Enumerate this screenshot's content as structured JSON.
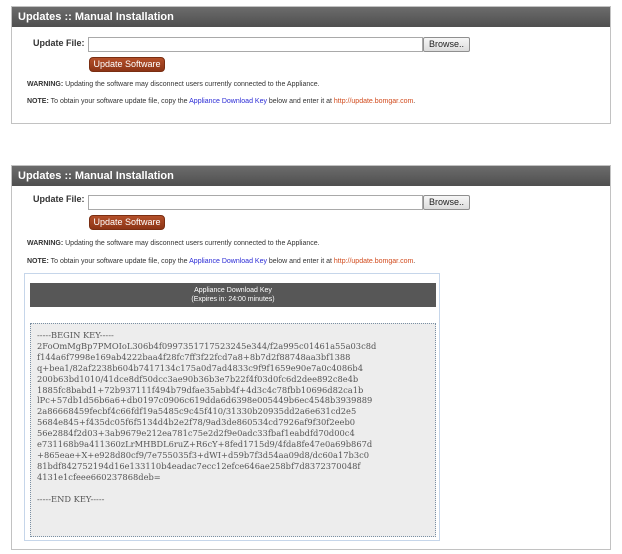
{
  "panel1": {
    "title": "Updates :: Manual Installation",
    "file_label": "Update File:",
    "browse_label": "Browse..",
    "update_button": "Update Software",
    "warning_prefix": "WARNING:",
    "warning_text": " Updating the software may disconnect users currently connected to the Appliance.",
    "note_prefix": "NOTE:",
    "note_text": " To obtain your software update file, copy the ",
    "note_key_link": "Appliance Download Key",
    "note_text2": " below and enter it at ",
    "note_url": "http://update.bomgar.com",
    "note_end": "."
  },
  "panel2": {
    "title": "Updates :: Manual Installation",
    "file_label": "Update File:",
    "browse_label": "Browse..",
    "update_button": "Update Software",
    "warning_prefix": "WARNING:",
    "warning_text": " Updating the software may disconnect users currently connected to the Appliance.",
    "note_prefix": "NOTE:",
    "note_text": " To obtain your software update file, copy the ",
    "note_key_link": "Appliance Download Key",
    "note_text2": " below and enter it at ",
    "note_url": "http://update.bomgar.com",
    "note_end": ".",
    "key_box": {
      "title": "Appliance Download Key",
      "subtitle": "(Expires in: 24:00 minutes)",
      "key_text": "-----BEGIN KEY-----\n2FoOmMgBp7PMOIoL306b4f0997351717523245e344/f2a995c01461a55a03c8d\nf144a6f7998e169ab4222baa4f28fc7ff3f22fcd7a8+8b7d2f88748aa3bf1388\nq+bea1/82af2238b604b7417134c175a0d7ad4833c9f9f1659e90e7a0c4086b4\n200b63bd1010/41dce8df50dcc3ae90b36b3e7b22f4f03d0fc6d2dee892c8e4b\n1885fc8babd1+72b937111f494b79dfae35abb4f+4d3c4c78fbb10696d82ca1b\nlPc+57db1d56b6a6+db0197c0906c619dda6d6398e005449b6ec4548b3939889\n2a86668459fecbf4c66fdf19a5485c9c45f410/31330b20935dd2a6e631cd2e5\n5684e845+f435dc05f6f5134d4b2e2f78/9ad3de860534cd7926af9f30f2eeb0\n56e2884f2d03+3ab9679e212ea781c75e2d2f9e0adc33fbaf1eabdfd70d00c4\ne731168b9a411360zLrMHBDL6ruZ+R6cY+8fed1715d9/4fda8fe47e0a69b867d\n+865eae+X+e928d80cf9/7e755035f3+dWI+d59b7f3d54aa09d8/dc60a17b3c0\n81bdf842752194d16e133110b4eadac7ecc12efce646ae258bf7d8372370048f\n4131e1cfeee660237868deb=\n\n-----END KEY-----"
    }
  }
}
